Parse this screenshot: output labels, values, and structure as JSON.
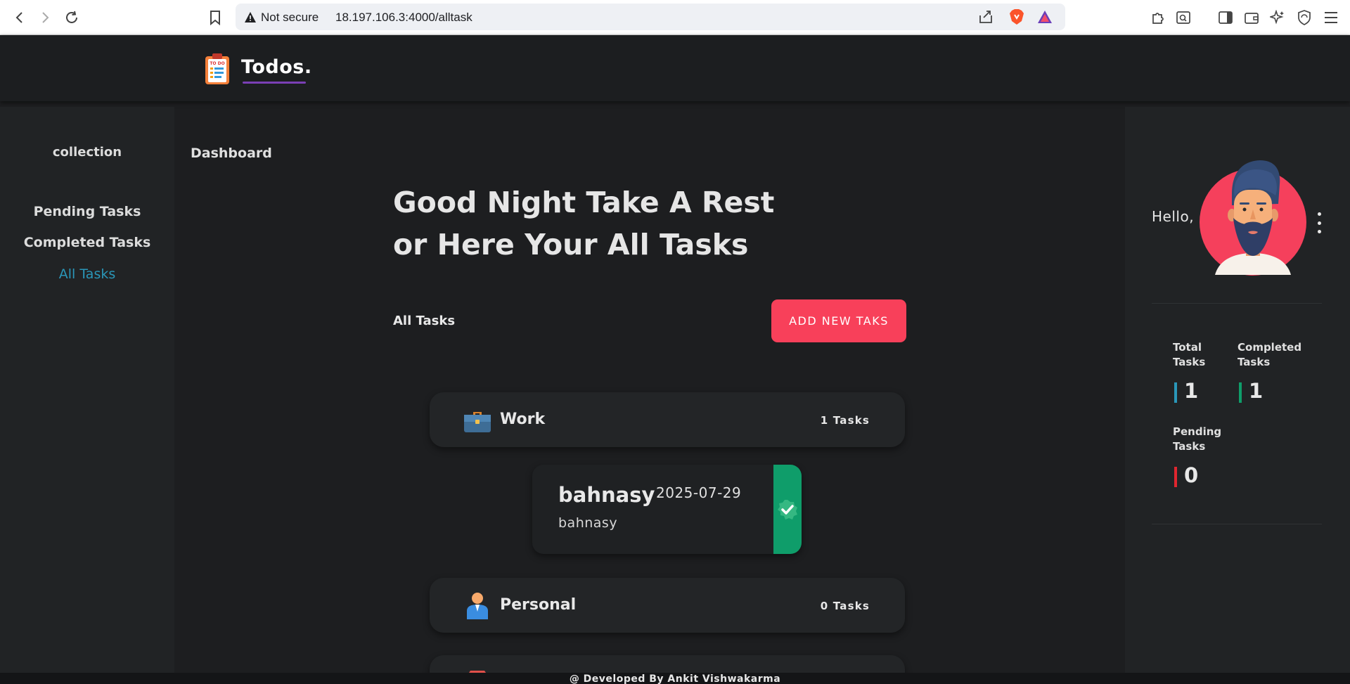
{
  "browser": {
    "security_label": "Not secure",
    "url": "18.197.106.3:4000/alltask"
  },
  "app": {
    "logo_text": "Todos.",
    "logo_badge": "TO DO"
  },
  "sidebar": {
    "title": "collection",
    "items": [
      {
        "label": "Pending Tasks",
        "active": false
      },
      {
        "label": "Completed Tasks",
        "active": false
      },
      {
        "label": "All Tasks",
        "active": true
      }
    ]
  },
  "main": {
    "breadcrumb": "Dashboard",
    "greeting": "Good Night Take A Rest or Here Your All Tasks",
    "section_label": "All Tasks",
    "add_button": "ADD NEW TAKS",
    "collections": [
      {
        "name": "Work",
        "count": "1 Tasks",
        "icon": "briefcase-icon"
      },
      {
        "name": "Personal",
        "count": "0 Tasks",
        "icon": "person-icon"
      }
    ],
    "task": {
      "title": "bahnasy",
      "date": "2025-07-29",
      "description": "bahnasy",
      "status": "completed"
    }
  },
  "profile": {
    "greeting": "Hello,",
    "stats": {
      "total": {
        "label": "Total Tasks",
        "value": "1",
        "color": "#2a97b9"
      },
      "completed": {
        "label": "Completed Tasks",
        "value": "1",
        "color": "#0f9d6a"
      },
      "pending": {
        "label": "Pending Tasks",
        "value": "0",
        "color": "#e0262f"
      }
    }
  },
  "footer": {
    "text": "@ Developed By Ankit Vishwakarma"
  },
  "colors": {
    "accent": "#f8405a",
    "active_link": "#2a97b9",
    "success": "#0f9d6a",
    "background": "#1d1e20",
    "panel": "#212325"
  }
}
